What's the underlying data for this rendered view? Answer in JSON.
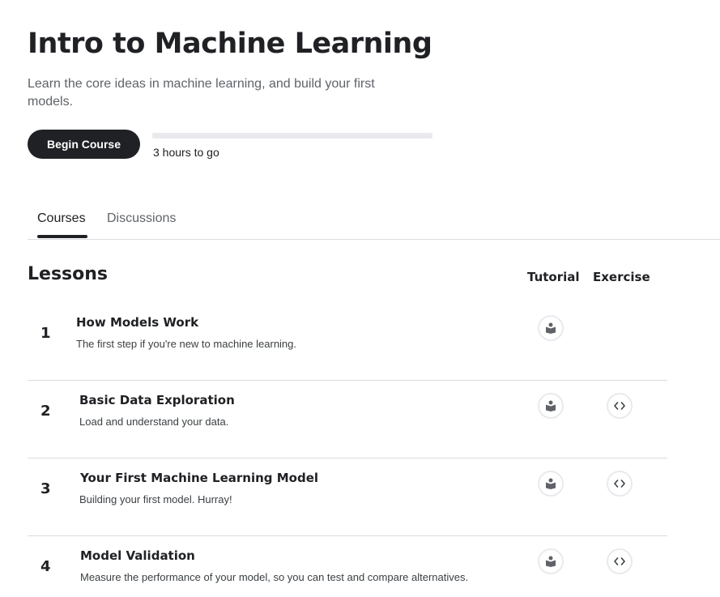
{
  "course": {
    "title": "Intro to Machine Learning",
    "subtitle": "Learn the core ideas in machine learning, and build your first models.",
    "begin_label": "Begin Course",
    "time_remaining": "3 hours to go",
    "progress": 0
  },
  "tabs": [
    {
      "label": "Courses",
      "active": true
    },
    {
      "label": "Discussions",
      "active": false
    }
  ],
  "lessons_section": {
    "heading": "Lessons",
    "col_tutorial": "Tutorial",
    "col_exercise": "Exercise",
    "items": [
      {
        "number": "1",
        "title": "How Models Work",
        "description": "The first step if you're new to machine learning.",
        "tutorial_icon": "book-icon",
        "exercise_icon": null
      },
      {
        "number": "2",
        "title": "Basic Data Exploration",
        "description": "Load and understand your data.",
        "tutorial_icon": "book-icon",
        "exercise_icon": "code-icon"
      },
      {
        "number": "3",
        "title": "Your First Machine Learning Model",
        "description": "Building your first model. Hurray!",
        "tutorial_icon": "book-icon",
        "exercise_icon": "code-icon"
      },
      {
        "number": "4",
        "title": "Model Validation",
        "description": "Measure the performance of your model, so you can test and compare alternatives.",
        "tutorial_icon": "book-icon",
        "exercise_icon": "code-icon"
      }
    ]
  },
  "colors": {
    "primary_text": "#202124",
    "secondary_text": "#5f6368",
    "divider": "#dadce0",
    "progress_track": "#e8eaed",
    "button_bg": "#202124"
  }
}
